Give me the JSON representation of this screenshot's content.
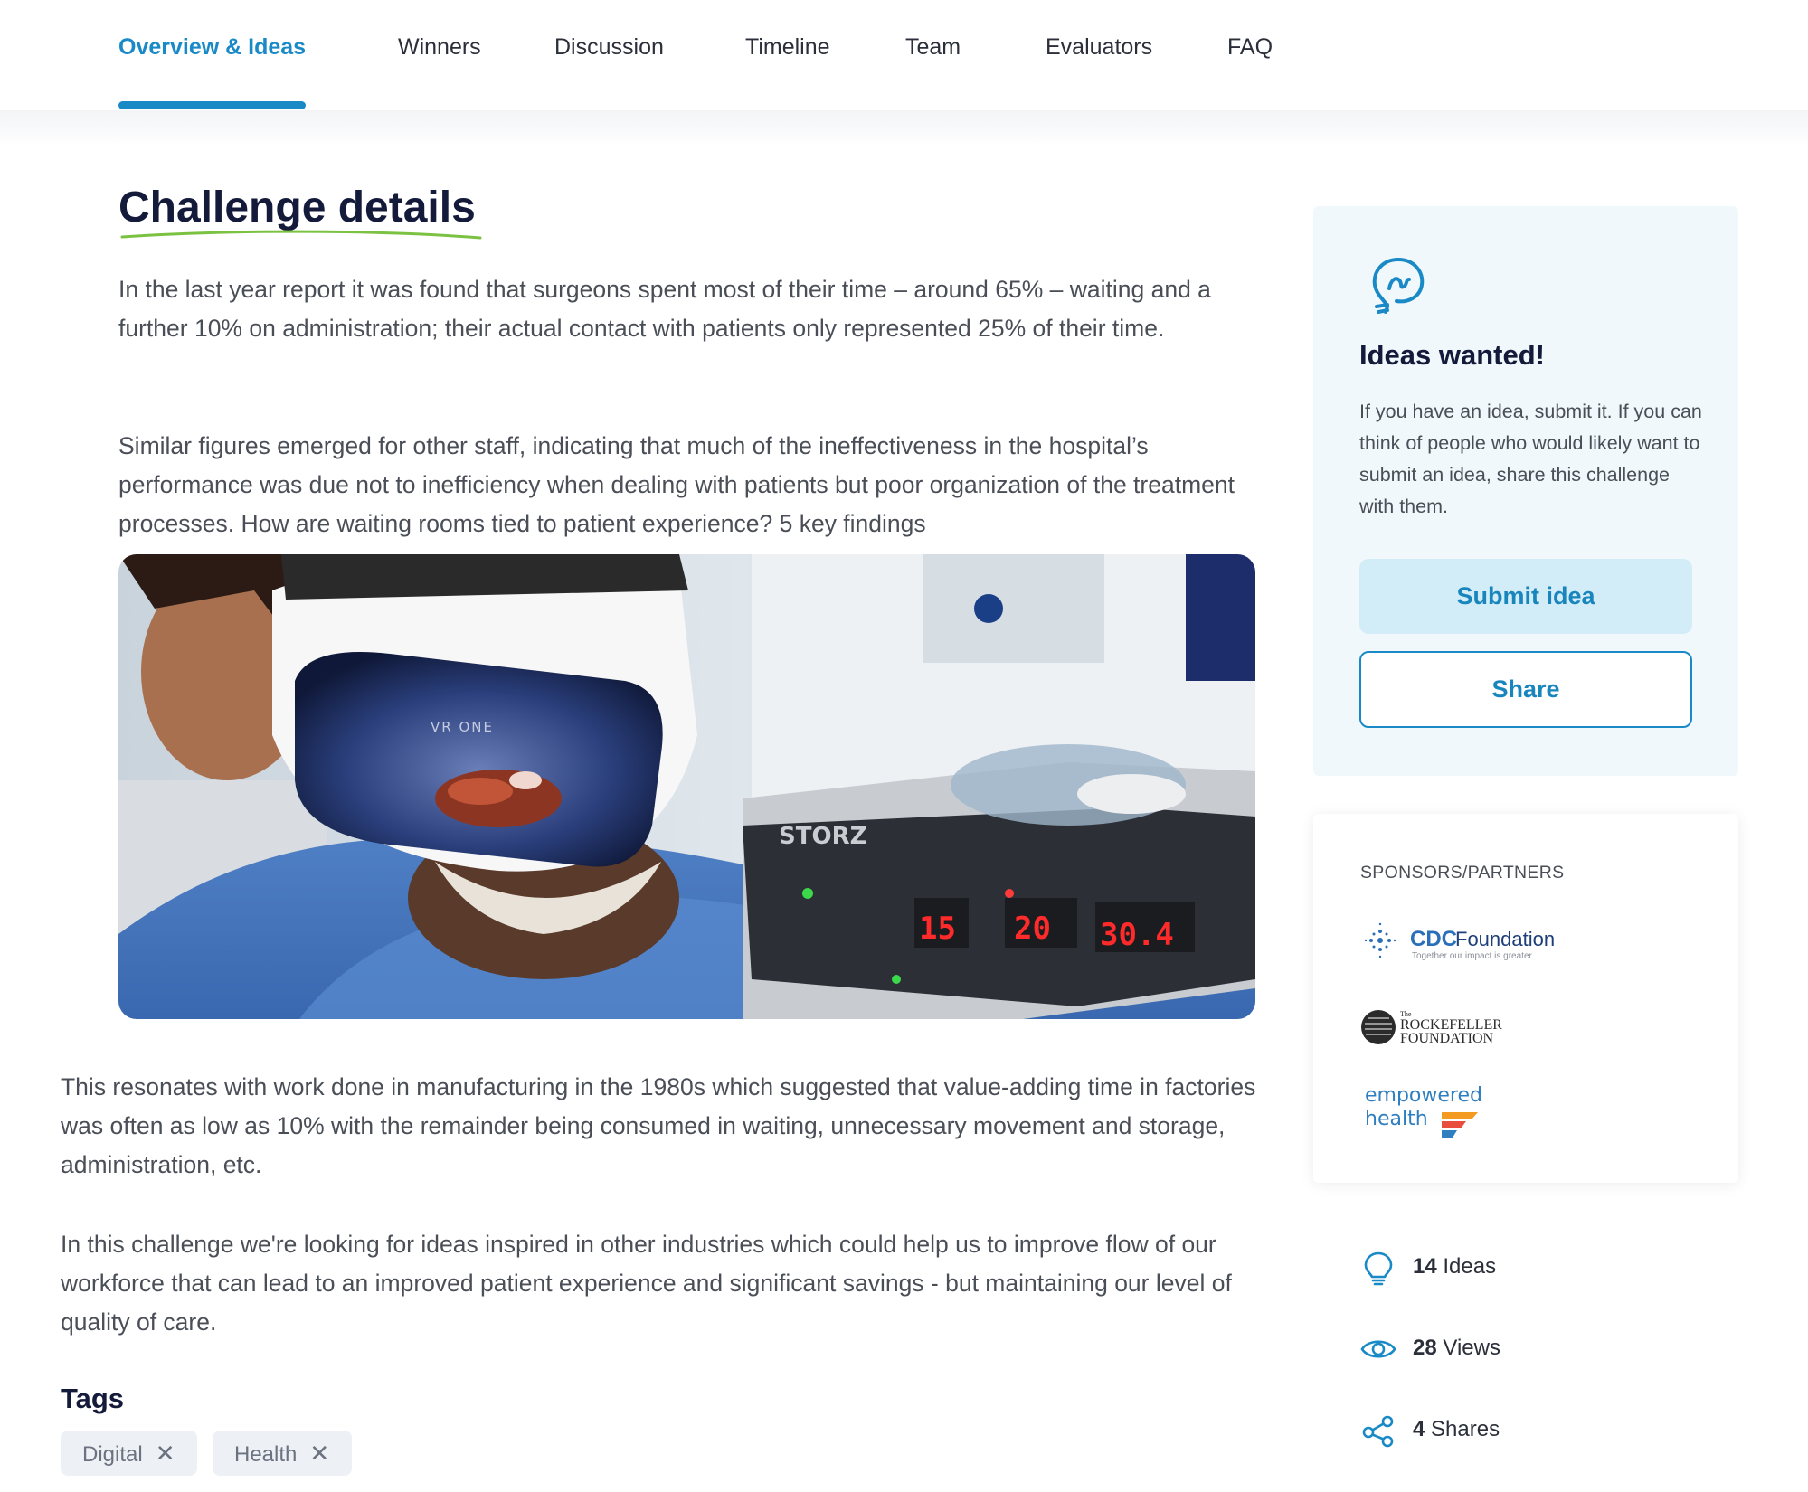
{
  "nav": {
    "tabs": [
      {
        "label": "Overview & Ideas",
        "active": true
      },
      {
        "label": "Winners"
      },
      {
        "label": "Discussion"
      },
      {
        "label": "Timeline"
      },
      {
        "label": "Team"
      },
      {
        "label": "Evaluators"
      },
      {
        "label": "FAQ"
      }
    ]
  },
  "main": {
    "heading": "Challenge details",
    "paragraphs": [
      "In the last year report it was found that surgeons spent most of their time – around 65% – waiting and a further 10% on administration; their actual contact with patients only represented 25% of their time.",
      "Similar figures emerged for other staff, indicating that much of the ineffectiveness in the hospital’s performance was due not to inefficiency when dealing with patients but poor organization of the treatment processes.  How are waiting rooms tied to patient experience? 5 key findings",
      "This resonates with work done in manufacturing in the 1980s which suggested that value-adding time in factories was often as low as 10% with the remainder being consumed in waiting, unnecessary movement and storage, administration, etc.",
      "In this challenge we're looking for ideas inspired in other industries which could help us to improve flow of our workforce that can lead to an improved patient experience and significant savings - but maintaining our level of quality of care."
    ],
    "image": {
      "headset_text": "VR ONE",
      "device_brand": "STORZ",
      "display_values": [
        "15",
        "20",
        "30.4"
      ]
    },
    "tags_title": "Tags",
    "tags": [
      "Digital",
      "Health"
    ],
    "tag_remove_symbol": "✕"
  },
  "sidebar": {
    "ideas_card": {
      "title": "Ideas wanted!",
      "text": "If you have an idea, submit it. If you can think of people who would likely want to submit an idea, share this challenge with them.",
      "submit_label": "Submit idea",
      "share_label": "Share"
    },
    "sponsors": {
      "label": "SPONSORS/PARTNERS",
      "cdc": {
        "name_bold": "CDC",
        "name_rest": "Foundation",
        "tagline": "Together our impact is greater"
      },
      "rockefeller": {
        "small": "The",
        "line1": "ROCKEFELLER",
        "line2": "FOUNDATION"
      },
      "empowered": {
        "line1": "empowered",
        "line2": "health"
      }
    },
    "stats": {
      "ideas": {
        "count": "14",
        "label": "Ideas"
      },
      "views": {
        "count": "28",
        "label": "Views"
      },
      "shares": {
        "count": "4",
        "label": "Shares"
      }
    }
  },
  "colors": {
    "accent": "#1a8ac7",
    "heading": "#131a3a",
    "body_text": "#4a4e57",
    "card_bg": "#f1f8fc",
    "submit_bg": "#d3edf8",
    "tag_bg": "#edf0f4",
    "underline_green": "#7cc242"
  }
}
